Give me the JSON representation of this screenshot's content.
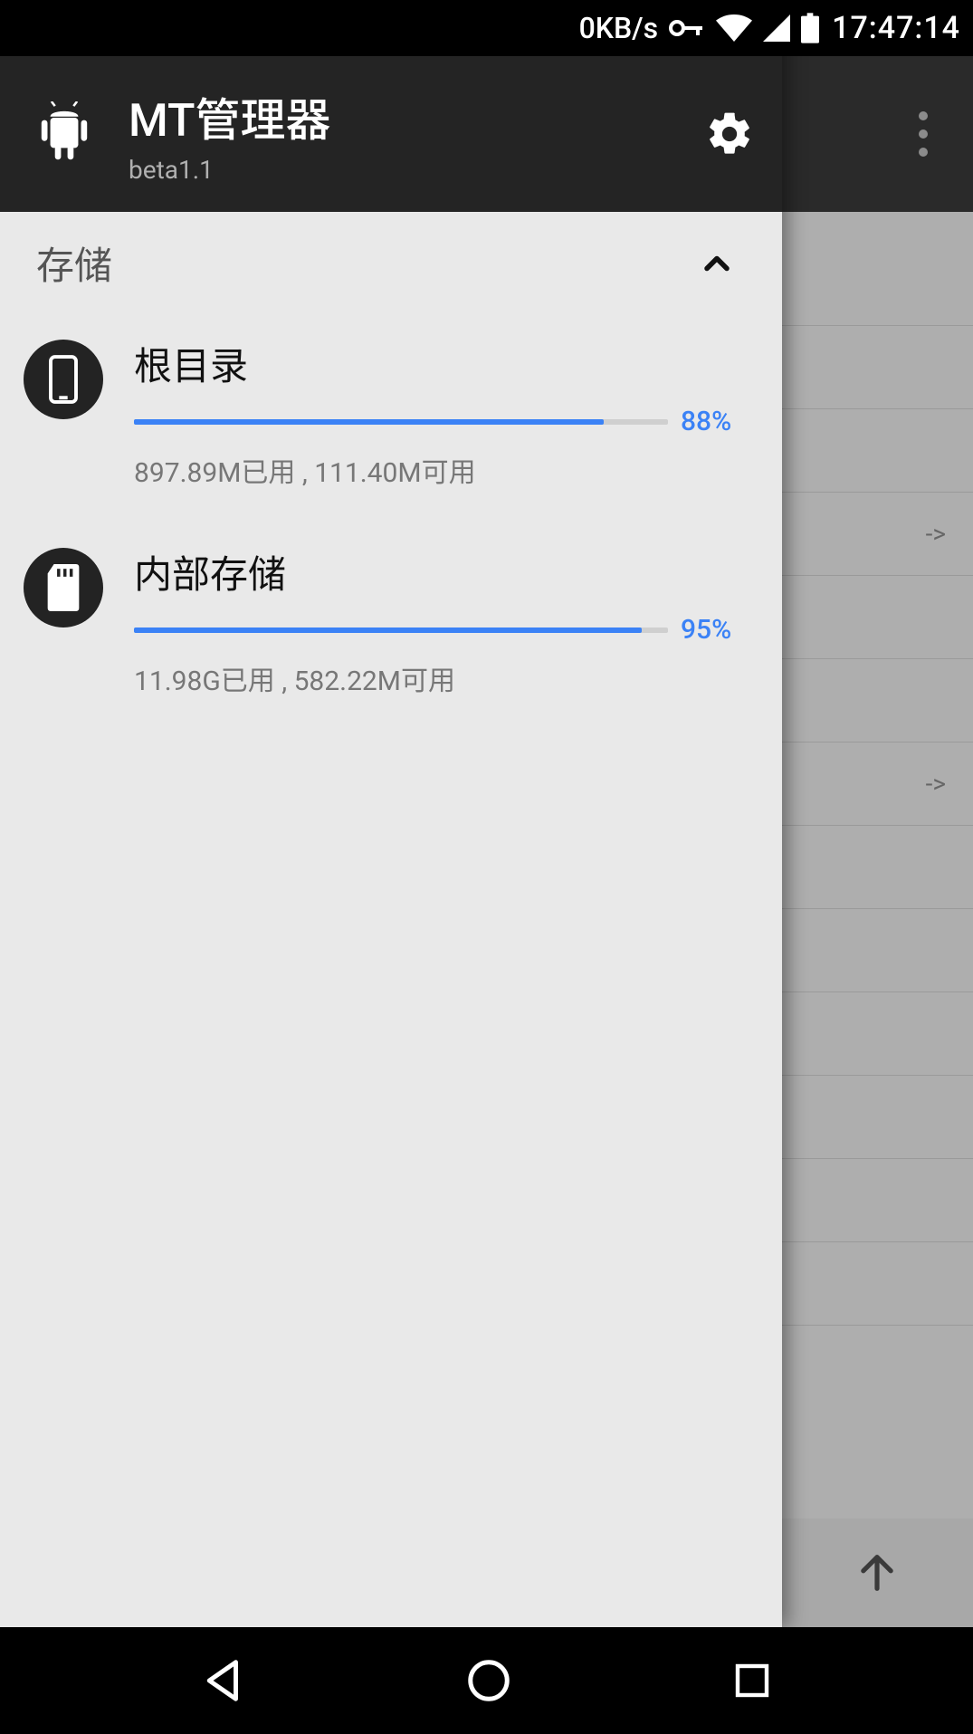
{
  "statusbar": {
    "net_speed": "0KB/s",
    "time": "17:47:14"
  },
  "drawer": {
    "title": "MT管理器",
    "subtitle": "beta1.1",
    "section_title": "存储",
    "items": [
      {
        "name": "根目录",
        "percent_label": "88%",
        "percent_value": 88,
        "detail": "897.89M已用 , 111.40M可用"
      },
      {
        "name": "内部存储",
        "percent_label": "95%",
        "percent_value": 95,
        "detail": "11.98G已用 , 582.22M可用"
      }
    ]
  },
  "backdrop": {
    "rows_arrow_1": "->",
    "rows_arrow_2": "->"
  }
}
